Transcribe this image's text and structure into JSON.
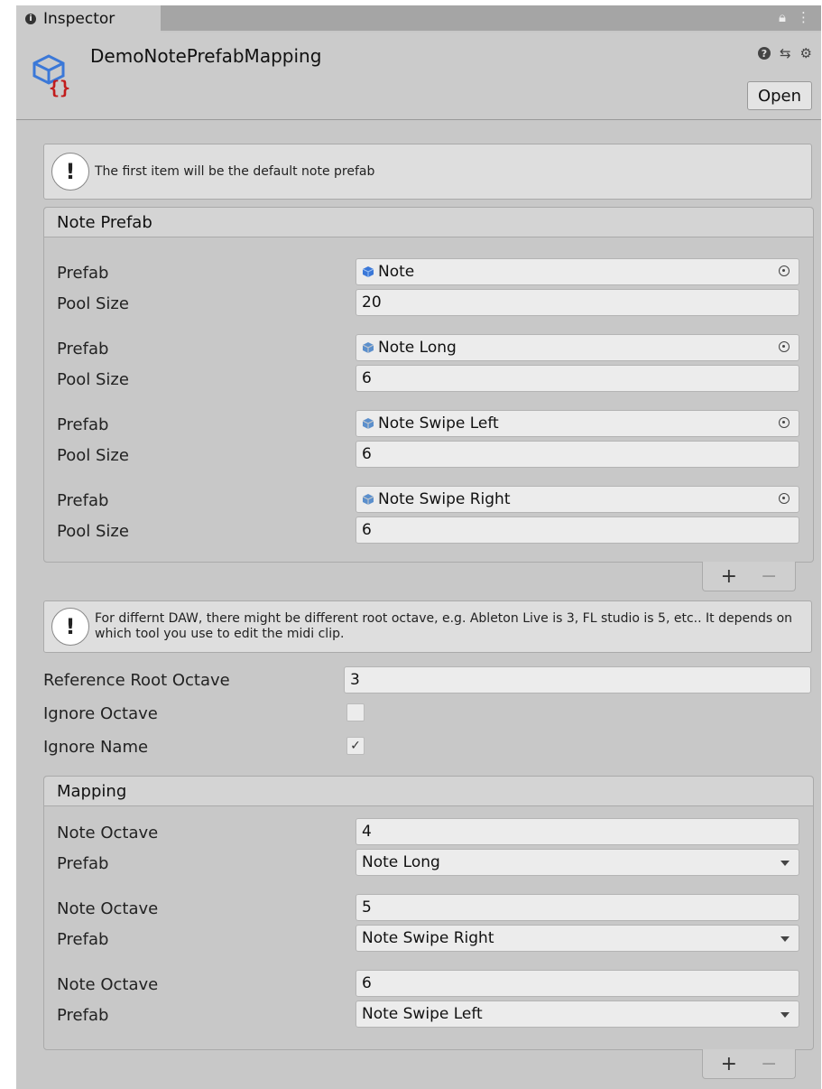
{
  "tab": {
    "label": "Inspector",
    "right_icons": [
      "lock-icon",
      "kebab-menu-icon"
    ]
  },
  "header": {
    "title": "DemoNotePrefabMapping",
    "open_label": "Open"
  },
  "help1": "The first item will be the default note prefab",
  "note_prefab": {
    "title": "Note Prefab",
    "prefab_label": "Prefab",
    "pool_label": "Pool Size",
    "items": [
      {
        "prefab": "Note",
        "pool": "20"
      },
      {
        "prefab": "Note Long",
        "pool": "6"
      },
      {
        "prefab": "Note Swipe Left",
        "pool": "6"
      },
      {
        "prefab": "Note Swipe Right",
        "pool": "6"
      }
    ]
  },
  "help2": "For differnt DAW, there might be different root octave, e.g. Ableton Live is 3, FL studio is 5, etc.. It depends on which tool you use to edit the midi clip.",
  "settings": {
    "ref_root_label": "Reference Root Octave",
    "ref_root_value": "3",
    "ignore_octave_label": "Ignore Octave",
    "ignore_octave_checked": false,
    "ignore_name_label": "Ignore Name",
    "ignore_name_checked": true
  },
  "mapping": {
    "title": "Mapping",
    "octave_label": "Note Octave",
    "prefab_label": "Prefab",
    "items": [
      {
        "octave": "4",
        "prefab": "Note Long"
      },
      {
        "octave": "5",
        "prefab": "Note Swipe Right"
      },
      {
        "octave": "6",
        "prefab": "Note Swipe Left"
      }
    ]
  },
  "list_buttons": {
    "plus": "+",
    "minus": "−"
  },
  "colors": {
    "accent_cube": "#3b78d8"
  }
}
